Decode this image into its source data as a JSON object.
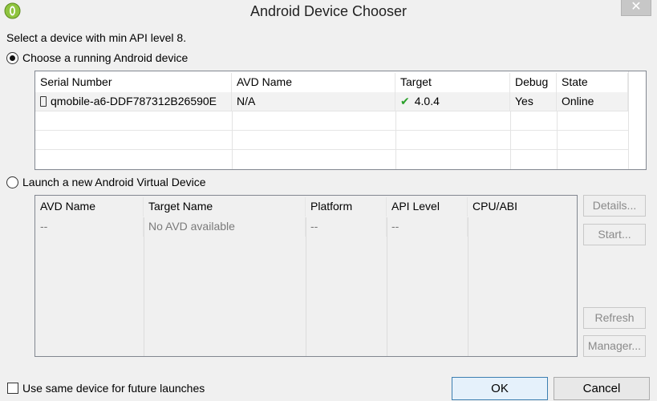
{
  "window": {
    "title": "Android Device Chooser",
    "close_glyph": "✕"
  },
  "prompt": "Select a device with min API level 8.",
  "running": {
    "radio_label": "Choose a running Android device",
    "selected": true,
    "headers": [
      "Serial Number",
      "AVD Name",
      "Target",
      "Debug",
      "State"
    ],
    "rows": [
      {
        "serial": "qmobile-a6-DDF787312B26590E",
        "avd": "N/A",
        "target": "4.0.4",
        "debug": "Yes",
        "state": "Online"
      }
    ]
  },
  "launch": {
    "radio_label": "Launch a new Android Virtual Device",
    "selected": false,
    "headers": [
      "AVD Name",
      "Target Name",
      "Platform",
      "API Level",
      "CPU/ABI"
    ],
    "rows": [
      {
        "avd": "--",
        "target": "No AVD available",
        "platform": "--",
        "api": "--",
        "cpu": ""
      }
    ],
    "buttons": {
      "details": "Details...",
      "start": "Start...",
      "refresh": "Refresh",
      "manager": "Manager..."
    }
  },
  "footer": {
    "checkbox_label": "Use same device for future launches",
    "checkbox_checked": false,
    "ok": "OK",
    "cancel": "Cancel"
  },
  "icons": {
    "app": "android-icon",
    "device": "phone-icon",
    "target_ok": "checkmark-icon"
  },
  "colors": {
    "checkmark": "#2aa02a",
    "default_button_border": "#3c7fb1"
  }
}
